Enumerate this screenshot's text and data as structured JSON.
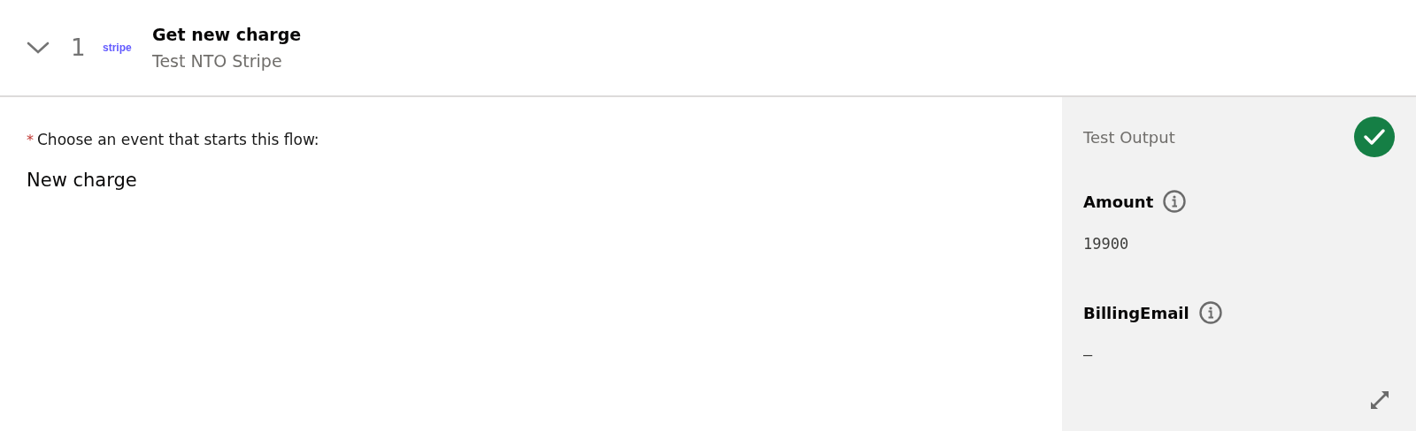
{
  "step": {
    "number": "1",
    "expanded": true,
    "app_logo": "stripe",
    "title": "Get new charge",
    "subtitle": "Test NTO Stripe"
  },
  "trigger": {
    "required_mark": "*",
    "label": "Choose an event that starts this flow:",
    "value": "New charge"
  },
  "test_output": {
    "title": "Test Output",
    "passed": true,
    "fields": [
      {
        "name": "Amount",
        "value": "19900"
      },
      {
        "name": "BillingEmail",
        "value": "–"
      }
    ]
  }
}
